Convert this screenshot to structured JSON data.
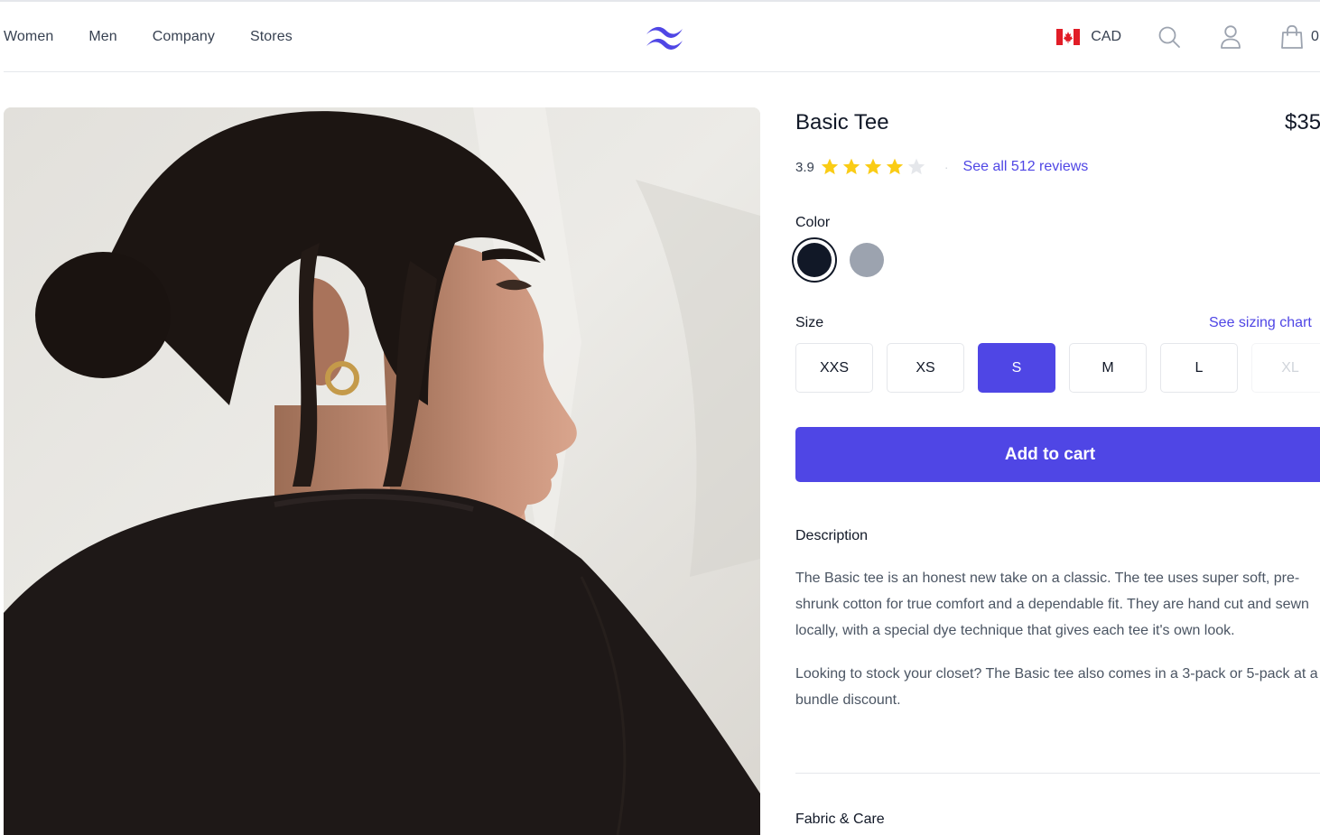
{
  "nav": {
    "links": [
      "Women",
      "Men",
      "Company",
      "Stores"
    ],
    "currency": "CAD",
    "cart_count": "0"
  },
  "product": {
    "name": "Basic Tee",
    "price": "$35",
    "rating": "3.9",
    "rating_stars": 3.9,
    "reviews_link": "See all 512 reviews",
    "image_alt": "Back of woman's shoulders with black t-shirt and hair in a bun",
    "color_label": "Color",
    "colors": [
      {
        "name": "Black",
        "hex": "#111827",
        "selected": true
      },
      {
        "name": "Heather Grey",
        "hex": "#9ca3af",
        "selected": false
      }
    ],
    "size_label": "Size",
    "sizing_chart_link": "See sizing chart",
    "sizes": [
      {
        "label": "XXS",
        "state": "available"
      },
      {
        "label": "XS",
        "state": "available"
      },
      {
        "label": "S",
        "state": "selected"
      },
      {
        "label": "M",
        "state": "available"
      },
      {
        "label": "L",
        "state": "available"
      },
      {
        "label": "XL",
        "state": "disabled"
      }
    ],
    "add_to_cart": "Add to cart",
    "description_title": "Description",
    "description": [
      "The Basic tee is an honest new take on a classic. The tee uses super soft, pre-shrunk cotton for true comfort and a dependable fit. They are hand cut and sewn locally, with a special dye technique that gives each tee it's own look.",
      "Looking to stock your closet? The Basic tee also comes in a 3-pack or 5-pack at a bundle discount."
    ],
    "fabric_title": "Fabric & Care"
  },
  "colors": {
    "accent": "#4f46e5",
    "star_filled": "#facc15",
    "star_empty": "#e5e7eb"
  }
}
